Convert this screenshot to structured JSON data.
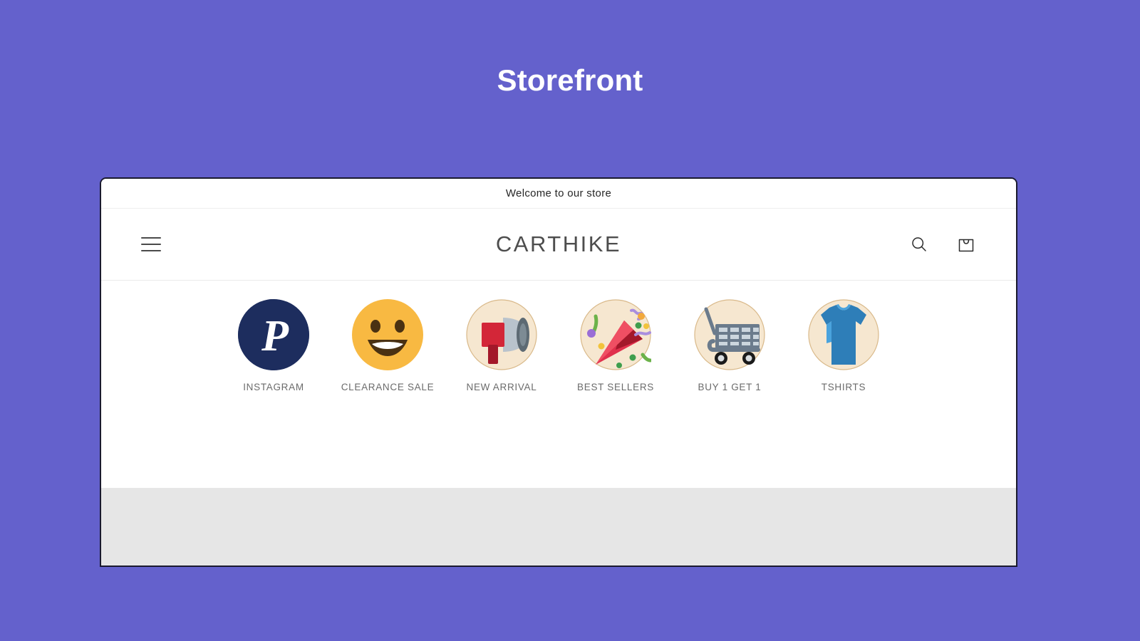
{
  "page": {
    "heading": "Storefront",
    "background_color": "#6461cc",
    "heading_color": "#ffffff"
  },
  "store": {
    "announcement": {
      "text": "Welcome to our store"
    },
    "header": {
      "menu_icon": "hamburger-menu-icon",
      "logo_text": "CARTHIKE",
      "search_icon": "search-icon",
      "cart_icon": "shopping-cart-icon"
    },
    "collections": [
      {
        "label": "INSTAGRAM",
        "icon": "paypal-p-logo",
        "circle_color": "#1d2d5e",
        "mark_color": "#ffffff"
      },
      {
        "label": "CLEARANCE SALE",
        "icon": "grinning-face-emoji",
        "circle_color": "#f8b942",
        "mark_color": "#4a3112"
      },
      {
        "label": "NEW ARRIVAL",
        "icon": "megaphone-emoji",
        "circle_color": "#f6e7d0",
        "mark_color": "#d32638"
      },
      {
        "label": "BEST SELLERS",
        "icon": "party-popper-emoji",
        "circle_color": "#f6e7d0",
        "mark_color": "#e0304c"
      },
      {
        "label": "BUY 1 GET 1",
        "icon": "shopping-cart-emoji",
        "circle_color": "#f6e7d0",
        "mark_color": "#6b7b8c"
      },
      {
        "label": "TSHIRTS",
        "icon": "t-shirt-emoji",
        "circle_color": "#f6e7d0",
        "mark_color": "#2e7eb8"
      }
    ],
    "footer": {
      "background_color": "#e6e6e6"
    }
  }
}
